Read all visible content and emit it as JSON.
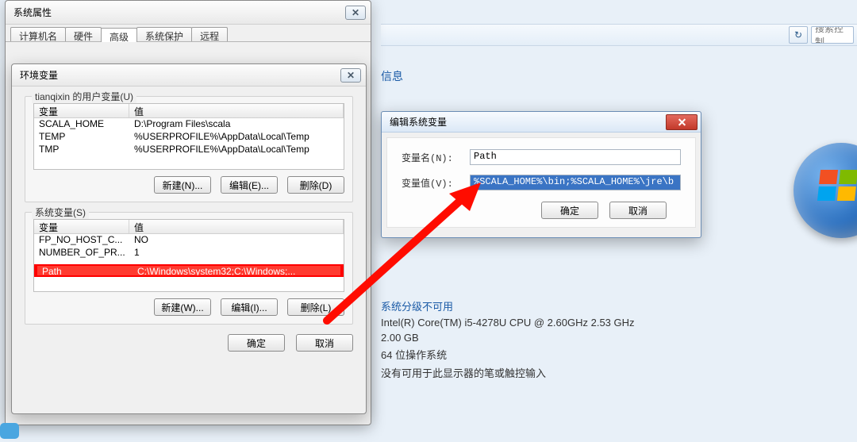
{
  "topbar": {
    "search_placeholder": "搜索控制"
  },
  "sysprops": {
    "title": "系统属性",
    "tabs": [
      "计算机名",
      "硬件",
      "高级",
      "系统保护",
      "远程"
    ],
    "active_tab_index": 2
  },
  "envvars": {
    "title": "环境变量",
    "user_group_title": "tianqixin 的用户变量(U)",
    "system_group_title": "系统变量(S)",
    "header_name": "变量",
    "header_value": "值",
    "user_rows": [
      {
        "name": "SCALA_HOME",
        "value": "D:\\Program Files\\scala"
      },
      {
        "name": "TEMP",
        "value": "%USERPROFILE%\\AppData\\Local\\Temp"
      },
      {
        "name": "TMP",
        "value": "%USERPROFILE%\\AppData\\Local\\Temp"
      }
    ],
    "system_rows": [
      {
        "name": "FP_NO_HOST_C...",
        "value": "NO"
      },
      {
        "name": "NUMBER_OF_PR...",
        "value": "1"
      }
    ],
    "system_selected_row": {
      "name": "Path",
      "value": "C:\\Windows\\system32;C:\\Windows;..."
    },
    "user_buttons": {
      "new": "新建(N)...",
      "edit": "编辑(E)...",
      "del": "删除(D)"
    },
    "sys_buttons": {
      "new": "新建(W)...",
      "edit": "编辑(I)...",
      "del": "删除(L)"
    },
    "ok": "确定",
    "cancel": "取消"
  },
  "editvar": {
    "title": "编辑系统变量",
    "name_label": "变量名(N):",
    "name_value": "Path",
    "value_label": "变量值(V):",
    "value_value": "%SCALA_HOME%\\bin;%SCALA_HOME%\\jre\\b",
    "ok": "确定",
    "cancel": "取消"
  },
  "sysinfo": {
    "heading1": "信息",
    "rating_heading": "系统分级不可用",
    "cpu": "Intel(R) Core(TM) i5-4278U CPU @ 2.60GHz   2.53 GHz",
    "ram": "2.00 GB",
    "os_type": "64 位操作系统",
    "pen": "没有可用于此显示器的笔或触控输入"
  }
}
